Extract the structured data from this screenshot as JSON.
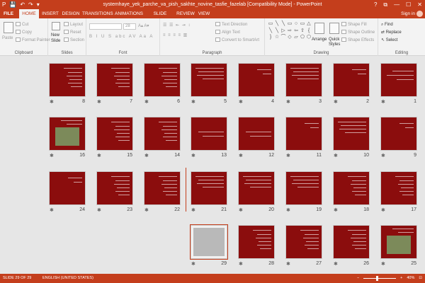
{
  "window": {
    "title": "systemhaye_yek_parche_va_pish_sakhte_novine_tasfie_fazelab [Compatibility Mode] - PowerPoint",
    "qat": [
      "P",
      "💾",
      "↶",
      "↷",
      "▾"
    ],
    "controls": [
      "?",
      "⧉",
      "—",
      "☐",
      "✕"
    ]
  },
  "tabs": {
    "file": "FILE",
    "items": [
      "HOME",
      "INSERT",
      "DESIGN",
      "TRANSITIONS",
      "ANIMATIONS",
      "SLIDE SHOW",
      "REVIEW",
      "VIEW"
    ],
    "active": "HOME",
    "sign_in": "Sign in"
  },
  "ribbon": {
    "clipboard": {
      "label": "Clipboard",
      "paste": "Paste",
      "cut": "Cut",
      "copy": "Copy",
      "format_painter": "Format Painter"
    },
    "slides": {
      "label": "Slides",
      "new_slide": "New",
      "new_slide_2": "Slide",
      "layout": "Layout",
      "reset": "Reset",
      "section": "Section"
    },
    "font": {
      "label": "Font",
      "size": "28",
      "glyphs": [
        "B",
        "I",
        "U",
        "S",
        "abc",
        "AV",
        "Aa",
        "A"
      ]
    },
    "paragraph": {
      "label": "Paragraph",
      "text_direction": "Text Direction",
      "align_text": "Align Text",
      "convert_smartart": "Convert to SmartArt"
    },
    "drawing": {
      "label": "Drawing",
      "arrange": "Arrange",
      "quick_styles": "Quick",
      "quick_styles_2": "Styles",
      "shape_fill": "Shape Fill",
      "shape_outline": "Shape Outline",
      "shape_effects": "Shape Effects",
      "shapes": [
        "▭",
        "╲",
        "╲",
        "▭",
        "○",
        "▭",
        "△",
        "╲",
        "╲",
        "▷",
        "⇨",
        "⇦",
        "⇧",
        "{",
        "}",
        "☆",
        "⌒",
        "◇",
        "▱",
        "⬠",
        "⬡"
      ]
    },
    "editing": {
      "label": "Editing",
      "find": "Find",
      "replace": "Replace",
      "select": "Select"
    }
  },
  "slides": [
    {
      "n": "1",
      "kind": "title"
    },
    {
      "n": "2",
      "kind": "sparse"
    },
    {
      "n": "3",
      "kind": "text"
    },
    {
      "n": "4",
      "kind": "sparse"
    },
    {
      "n": "5",
      "kind": "text"
    },
    {
      "n": "6",
      "kind": "list"
    },
    {
      "n": "7",
      "kind": "list"
    },
    {
      "n": "8",
      "kind": "list"
    },
    {
      "n": "9",
      "kind": "sparse"
    },
    {
      "n": "10",
      "kind": "text"
    },
    {
      "n": "11",
      "kind": "sparse"
    },
    {
      "n": "12",
      "kind": "center"
    },
    {
      "n": "13",
      "kind": "center"
    },
    {
      "n": "14",
      "kind": "list"
    },
    {
      "n": "15",
      "kind": "list"
    },
    {
      "n": "16",
      "kind": "picture"
    },
    {
      "n": "17",
      "kind": "list"
    },
    {
      "n": "18",
      "kind": "list"
    },
    {
      "n": "19",
      "kind": "text"
    },
    {
      "n": "20",
      "kind": "text"
    },
    {
      "n": "21",
      "kind": "text"
    },
    {
      "n": "22",
      "kind": "list"
    },
    {
      "n": "23",
      "kind": "list"
    },
    {
      "n": "24",
      "kind": "sparse"
    },
    {
      "n": "25",
      "kind": "picture"
    },
    {
      "n": "26",
      "kind": "list"
    },
    {
      "n": "27",
      "kind": "list"
    },
    {
      "n": "28",
      "kind": "list"
    },
    {
      "n": "29",
      "kind": "photo"
    }
  ],
  "star": "✱",
  "status": {
    "slide": "SLIDE 29 OF 29",
    "language": "ENGLISH (UNITED STATES)",
    "zoom": "40%",
    "zoom_minus": "−",
    "zoom_plus": "+"
  },
  "colors": {
    "accent": "#c43e1c",
    "slide_bg": "#8b0d0d"
  }
}
